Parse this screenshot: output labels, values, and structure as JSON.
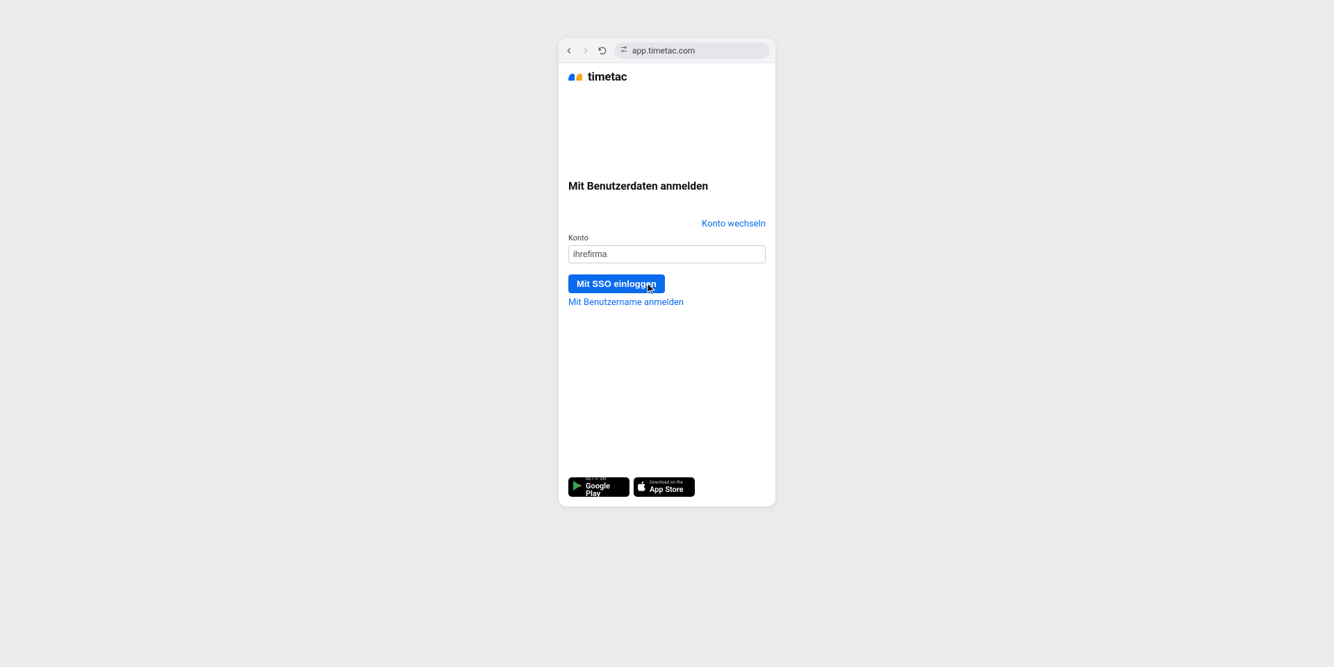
{
  "browser": {
    "url": "app.timetac.com"
  },
  "brand": {
    "name": "timetac"
  },
  "login": {
    "heading": "Mit Benutzerdaten anmelden",
    "switch_account": "Konto wechseln",
    "account_label": "Konto",
    "account_value": "ihrefirma",
    "sso_button": "Mit SSO einloggen",
    "username_link": "Mit Benutzername anmelden"
  },
  "badges": {
    "google": {
      "small": "GET IT ON",
      "big": "Google Play"
    },
    "apple": {
      "small": "Download on the",
      "big": "App Store"
    }
  }
}
